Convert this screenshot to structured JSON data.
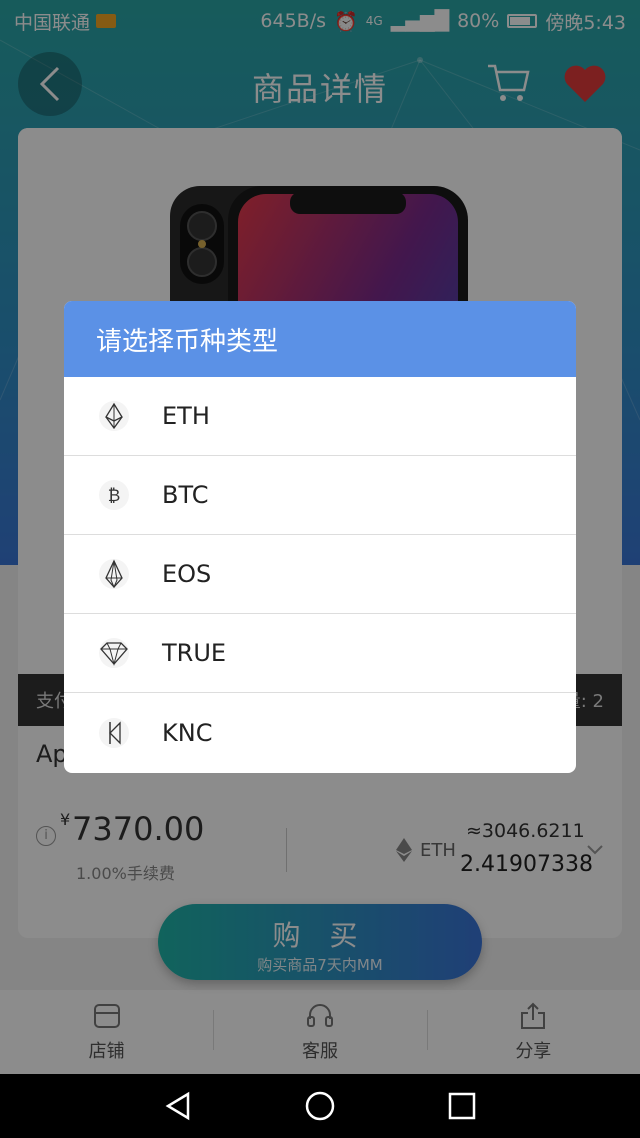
{
  "status_bar": {
    "carrier": "中国联通",
    "net_speed": "645B/s",
    "signal": "4G",
    "battery": "80%",
    "time": "傍晚5:43"
  },
  "header": {
    "title": "商品详情",
    "back_icon": "chevron-left-icon",
    "cart_icon": "cart-icon",
    "favorite_icon": "heart-icon"
  },
  "product": {
    "info_left": "支付",
    "info_right": "量: 2",
    "name": "Ap",
    "currency_symbol": "¥",
    "price": "7370.00",
    "fee": "1.00%手续费",
    "coin": "ETH",
    "approx": "≈3046.6211",
    "coin_amount": "2.41907338"
  },
  "buy_button": {
    "label": "购 买",
    "sub": "购买商品7天内MM"
  },
  "tabs": [
    {
      "label": "店铺",
      "icon": "store-icon"
    },
    {
      "label": "客服",
      "icon": "headset-icon"
    },
    {
      "label": "分享",
      "icon": "share-icon"
    }
  ],
  "dialog": {
    "title": "请选择币种类型",
    "options": [
      {
        "label": "ETH",
        "icon": "ethereum-icon"
      },
      {
        "label": "BTC",
        "icon": "bitcoin-icon"
      },
      {
        "label": "EOS",
        "icon": "eos-icon"
      },
      {
        "label": "TRUE",
        "icon": "truechain-icon"
      },
      {
        "label": "KNC",
        "icon": "kyber-icon"
      }
    ]
  },
  "colors": {
    "header_start": "#2aa7a6",
    "header_end": "#3a76d6",
    "dialog_header": "#5b91e6"
  }
}
